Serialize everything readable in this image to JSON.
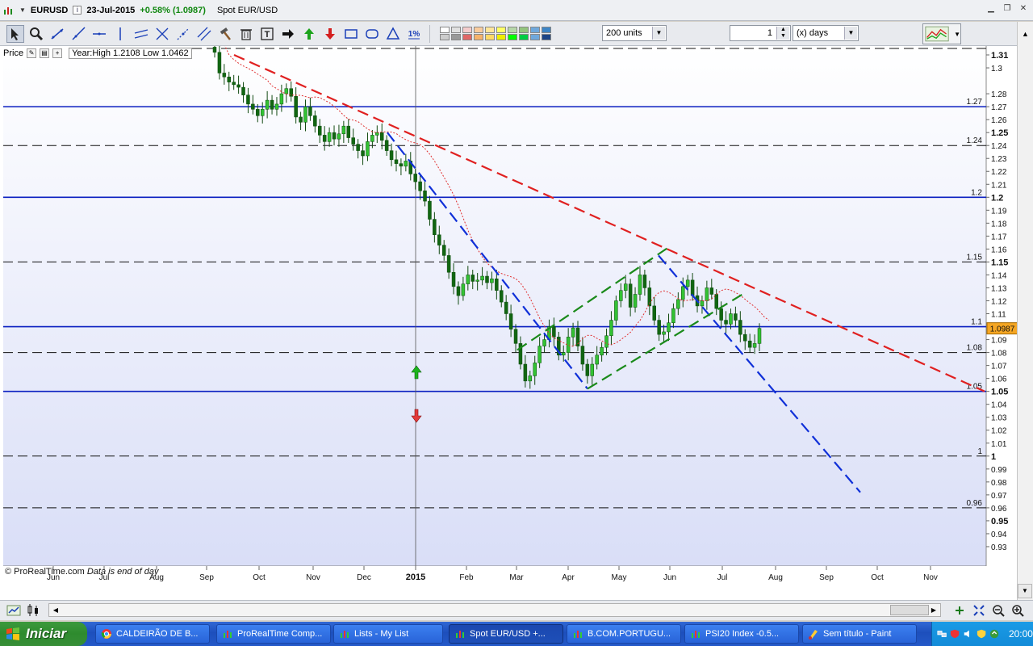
{
  "window": {
    "symbol": "EURUSD",
    "date": "23-Jul-2015",
    "change": "+0.58% (1.0987)",
    "description": "Spot EUR/USD",
    "controls": [
      "minimize",
      "restore",
      "close"
    ]
  },
  "toolbar": {
    "tools": [
      "cursor-icon",
      "zoom-icon",
      "line-icon",
      "ray-icon",
      "horizontal-line-icon",
      "vertical-line-icon",
      "channel-icon",
      "fibonacci-icon",
      "extend-icon",
      "parallel-icon",
      "hammer-icon",
      "trash-icon",
      "text-icon",
      "arrow-right-icon",
      "arrow-up-icon",
      "arrow-down-icon",
      "rectangle-icon",
      "ellipse-icon",
      "triangle-icon",
      "percent-icon"
    ],
    "swatch_colors": [
      "#ffffff",
      "#e0e0e0",
      "#f4cccc",
      "#f9cb9c",
      "#ffe599",
      "#ffff66",
      "#b6d7a8",
      "#93c47d",
      "#6fa8dc",
      "#3d85c6",
      "#cccccc",
      "#999999",
      "#e06666",
      "#f6b26b",
      "#ffd966",
      "#eeee00",
      "#00ff00",
      "#00cc44",
      "#6fa8dc",
      "#1c4587"
    ],
    "units_select": "200 units",
    "period_value": "1",
    "period_unit": "(x) days"
  },
  "chart_header": {
    "price_label": "Price",
    "year_info": "Year:High 1.2108 Low 1.0462"
  },
  "chart_data": {
    "type": "candlestick",
    "symbol": "EURUSD",
    "ylim": [
      0.92,
      1.31
    ],
    "x_labels": [
      "Jun",
      "Jul",
      "Aug",
      "Sep",
      "Oct",
      "Nov",
      "Dec",
      "2015",
      "Feb",
      "Mar",
      "Apr",
      "May",
      "Jun",
      "Jul",
      "Aug",
      "Sep",
      "Oct",
      "Nov"
    ],
    "y_ticks": [
      "1.31",
      "1.3",
      "1.28",
      "1.27",
      "1.26",
      "1.25",
      "1.24",
      "1.23",
      "1.22",
      "1.21",
      "1.2",
      "1.19",
      "1.18",
      "1.17",
      "1.16",
      "1.15",
      "1.14",
      "1.13",
      "1.12",
      "1.11",
      "1.09",
      "1.08",
      "1.07",
      "1.06",
      "1.05",
      "1.04",
      "1.03",
      "1.02",
      "1.01",
      "1",
      "0.99",
      "0.98",
      "0.97",
      "0.96",
      "0.95",
      "0.94",
      "0.93"
    ],
    "bold_y_ticks": [
      "1.31",
      "1.25",
      "1.2",
      "1.15",
      "1.05",
      "1",
      "0.95"
    ],
    "current_price": "1.0987",
    "horizontal_lines": [
      {
        "level": 1.27,
        "label": "1.27",
        "style": "solid"
      },
      {
        "level": 1.24,
        "label": "1.24",
        "style": "dashed"
      },
      {
        "level": 1.2,
        "label": "1.2",
        "style": "solid"
      },
      {
        "level": 1.15,
        "label": "1.15",
        "style": "dashed"
      },
      {
        "level": 1.1,
        "label": "1.1",
        "style": "solid"
      },
      {
        "level": 1.08,
        "label": "1.08",
        "style": "dashed"
      },
      {
        "level": 1.05,
        "label": "1.05",
        "style": "solid"
      },
      {
        "level": 1.0,
        "label": "1",
        "style": "dashed"
      },
      {
        "level": 0.96,
        "label": "0.96",
        "style": "dashed"
      }
    ],
    "candles_close": [
      1.312,
      1.296,
      1.293,
      1.289,
      1.287,
      1.285,
      1.279,
      1.272,
      1.268,
      1.263,
      1.268,
      1.275,
      1.268,
      1.272,
      1.28,
      1.284,
      1.278,
      1.262,
      1.258,
      1.27,
      1.263,
      1.255,
      1.248,
      1.243,
      1.25,
      1.245,
      1.249,
      1.255,
      1.246,
      1.241,
      1.236,
      1.232,
      1.243,
      1.248,
      1.25,
      1.244,
      1.236,
      1.229,
      1.226,
      1.224,
      1.228,
      1.218,
      1.212,
      1.205,
      1.197,
      1.183,
      1.171,
      1.163,
      1.155,
      1.142,
      1.131,
      1.124,
      1.133,
      1.14,
      1.135,
      1.136,
      1.139,
      1.134,
      1.137,
      1.128,
      1.119,
      1.11,
      1.098,
      1.087,
      1.071,
      1.058,
      1.062,
      1.072,
      1.085,
      1.09,
      1.1,
      1.092,
      1.078,
      1.08,
      1.092,
      1.099,
      1.085,
      1.071,
      1.062,
      1.071,
      1.078,
      1.084,
      1.093,
      1.105,
      1.12,
      1.128,
      1.133,
      1.115,
      1.125,
      1.14,
      1.13,
      1.116,
      1.105,
      1.094,
      1.096,
      1.103,
      1.114,
      1.121,
      1.131,
      1.136,
      1.124,
      1.116,
      1.12,
      1.13,
      1.125,
      1.114,
      1.105,
      1.102,
      1.11,
      1.105,
      1.094,
      1.089,
      1.084,
      1.087,
      1.0987
    ],
    "annotations": [
      "green up arrow",
      "red down arrow",
      "red dashed downtrend",
      "blue dashed downtrend (2)",
      "green dashed channel",
      "red dotted moving average"
    ]
  },
  "footer_note": {
    "brand": "© ProRealTime.com",
    "note": "Data is end of day"
  },
  "taskbar": {
    "start_label": "Iniciar",
    "tasks": [
      {
        "label": "CALDEIRÃO DE B...",
        "icon": "chrome-icon"
      },
      {
        "label": "ProRealTime Comp...",
        "icon": "prorealtime-icon"
      },
      {
        "label": "Lists - My List",
        "icon": "prorealtime-icon"
      },
      {
        "label": "Spot EUR/USD  +...",
        "icon": "prorealtime-icon",
        "active": true
      },
      {
        "label": "B.COM.PORTUGU...",
        "icon": "prorealtime-icon"
      },
      {
        "label": "PSI20 Index  -0.5...",
        "icon": "prorealtime-icon"
      },
      {
        "label": "Sem título - Paint",
        "icon": "paint-icon"
      }
    ],
    "clock": "20:00"
  }
}
